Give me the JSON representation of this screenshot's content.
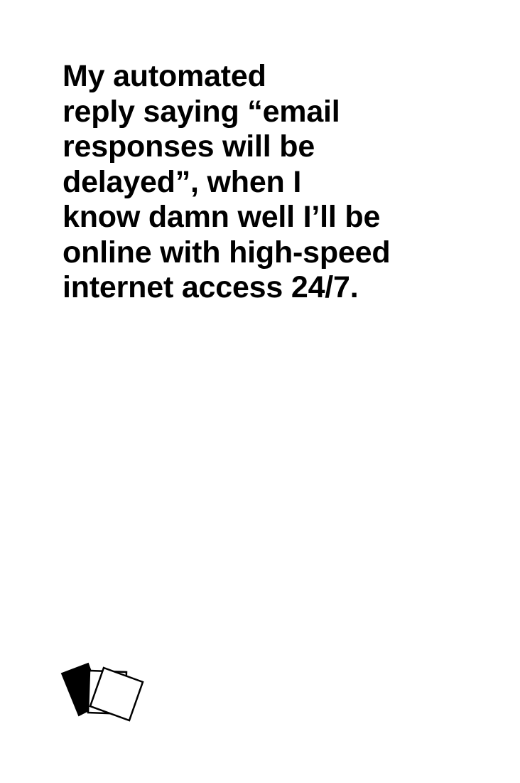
{
  "card": {
    "lines": [
      "My automated",
      "reply saying “email",
      "responses will be",
      "delayed”, when I",
      "know damn well I’ll be",
      "online with high-speed",
      "internet access 24/7."
    ]
  },
  "logo": {
    "icon": "stacked-cards-icon",
    "colors": {
      "back_card": "#000000",
      "front_card": "#ffffff",
      "stroke": "#000000"
    }
  }
}
